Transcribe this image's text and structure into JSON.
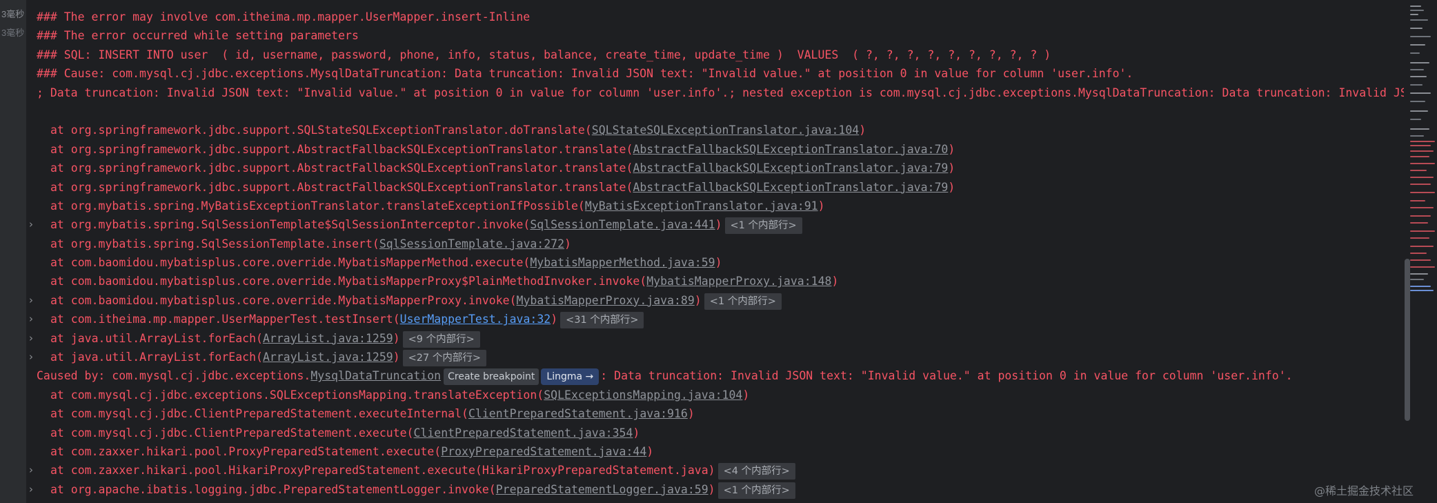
{
  "gutter": {
    "time1": "3毫秒",
    "time2": "3毫秒"
  },
  "lines": [
    {
      "text": "### The error may involve com.itheima.mp.mapper.UserMapper.insert-Inline"
    },
    {
      "text": "### The error occurred while setting parameters"
    },
    {
      "text": "### SQL: INSERT INTO user  ( id, username, password, phone, info, status, balance, create_time, update_time )  VALUES  ( ?, ?, ?, ?, ?, ?, ?, ?, ? )"
    },
    {
      "text": "### Cause: com.mysql.cj.jdbc.exceptions.MysqlDataTruncation: Data truncation: Invalid JSON text: \"Invalid value.\" at position 0 in value for column 'user.info'."
    },
    {
      "text": "; Data truncation: Invalid JSON text: \"Invalid value.\" at position 0 in value for column 'user.info'.; nested exception is com.mysql.cj.jdbc.exceptions.MysqlDataTruncation: Data truncation: Invalid JSON text: \"Invalid value.\" at position 0 in value for column 'user.info'."
    },
    {
      "text": ""
    },
    {
      "text": "at org.springframework.jdbc.support.SQLStateSQLExceptionTranslator.doTranslate(",
      "link": "SQLStateSQLExceptionTranslator.java:104",
      "after": ")"
    },
    {
      "text": "at org.springframework.jdbc.support.AbstractFallbackSQLExceptionTranslator.translate(",
      "link": "AbstractFallbackSQLExceptionTranslator.java:70",
      "after": ")"
    },
    {
      "text": "at org.springframework.jdbc.support.AbstractFallbackSQLExceptionTranslator.translate(",
      "link": "AbstractFallbackSQLExceptionTranslator.java:79",
      "after": ")"
    },
    {
      "text": "at org.springframework.jdbc.support.AbstractFallbackSQLExceptionTranslator.translate(",
      "link": "AbstractFallbackSQLExceptionTranslator.java:79",
      "after": ")"
    },
    {
      "text": "at org.mybatis.spring.MyBatisExceptionTranslator.translateExceptionIfPossible(",
      "link": "MyBatisExceptionTranslator.java:91",
      "after": ")"
    },
    {
      "text": "at org.mybatis.spring.SqlSessionTemplate$SqlSessionInterceptor.invoke(",
      "link": "SqlSessionTemplate.java:441",
      "after": ")",
      "chip": "<1 个内部行>",
      "expand": "›"
    },
    {
      "text": "at org.mybatis.spring.SqlSessionTemplate.insert(",
      "link": "SqlSessionTemplate.java:272",
      "after": ")"
    },
    {
      "text": "at com.baomidou.mybatisplus.core.override.MybatisMapperMethod.execute(",
      "link": "MybatisMapperMethod.java:59",
      "after": ")"
    },
    {
      "text": "at com.baomidou.mybatisplus.core.override.MybatisMapperProxy$PlainMethodInvoker.invoke(",
      "link": "MybatisMapperProxy.java:148",
      "after": ")"
    },
    {
      "text": "at com.baomidou.mybatisplus.core.override.MybatisMapperProxy.invoke(",
      "link": "MybatisMapperProxy.java:89",
      "after": ")",
      "chip": "<1 个内部行>",
      "expand": "›"
    },
    {
      "text": "at com.itheima.mp.mapper.UserMapperTest.testInsert(",
      "link": "UserMapperTest.java:32",
      "after": ")",
      "chip": "<31 个内部行>",
      "expand": "›",
      "blue": true
    },
    {
      "text": "at java.util.ArrayList.forEach(",
      "link": "ArrayList.java:1259",
      "after": ")",
      "chip": "<9 个内部行>",
      "expand": "›"
    },
    {
      "text": "at java.util.ArrayList.forEach(",
      "link": "ArrayList.java:1259",
      "after": ")",
      "chip": "<27 个内部行>",
      "expand": "›"
    },
    {
      "text": "Caused by: com.mysql.cj.jdbc.exceptions.",
      "link": "MysqlDataTruncation",
      "tooltip": "Create breakpoint",
      "badge": "Lingma →",
      "after": ": Data truncation: Invalid JSON text: \"Invalid value.\" at position 0 in value for column 'user.info'.",
      "caused": true
    },
    {
      "text": "at com.mysql.cj.jdbc.exceptions.SQLExceptionsMapping.translateException(",
      "link": "SQLExceptionsMapping.java:104",
      "after": ")"
    },
    {
      "text": "at com.mysql.cj.jdbc.ClientPreparedStatement.executeInternal(",
      "link": "ClientPreparedStatement.java:916",
      "after": ")"
    },
    {
      "text": "at com.mysql.cj.jdbc.ClientPreparedStatement.execute(",
      "link": "ClientPreparedStatement.java:354",
      "after": ")"
    },
    {
      "text": "at com.zaxxer.hikari.pool.ProxyPreparedStatement.execute(",
      "link": "ProxyPreparedStatement.java:44",
      "after": ")"
    },
    {
      "text": "at com.zaxxer.hikari.pool.HikariProxyPreparedStatement.execute(HikariProxyPreparedStatement.java)",
      "chip": "<4 个内部行>",
      "expand": "›"
    },
    {
      "text": "at org.apache.ibatis.logging.jdbc.PreparedStatementLogger.invoke(",
      "link": "PreparedStatementLogger.java:59",
      "after": ")",
      "chip": "<1 个内部行>",
      "expand": "›"
    }
  ],
  "watermark": "@稀土掘金技术社区",
  "colors": {
    "error_text": "#f75464",
    "link": "#8f939a",
    "link_active": "#589df6",
    "console_bg": "#1e1f22",
    "panel_bg": "#2b2d30"
  }
}
